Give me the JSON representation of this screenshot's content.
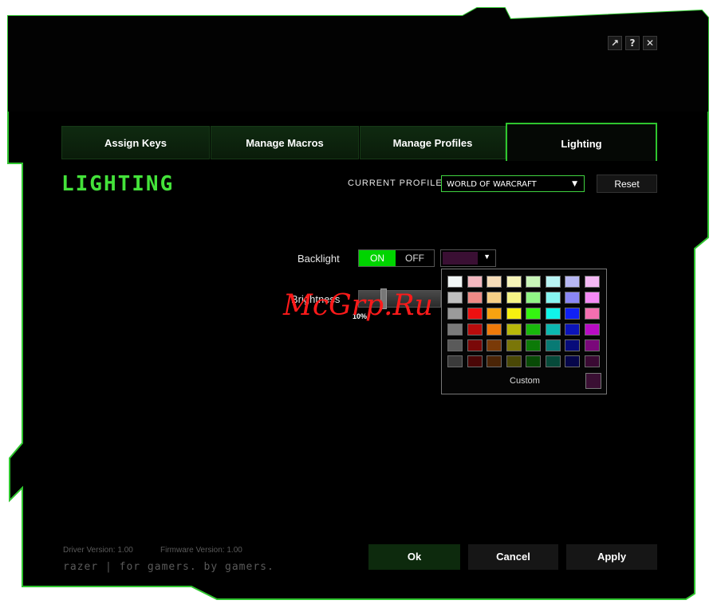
{
  "window": {
    "controls": [
      {
        "name": "settings-button",
        "glyph": "↗"
      },
      {
        "name": "help-button",
        "glyph": "?"
      },
      {
        "name": "close-button",
        "glyph": "✕"
      }
    ]
  },
  "tabs": [
    {
      "label": "Assign Keys"
    },
    {
      "label": "Manage Macros"
    },
    {
      "label": "Manage Profiles"
    },
    {
      "label": "Lighting"
    }
  ],
  "page_title": "Lighting",
  "profile": {
    "label": "CURRENT PROFILE",
    "value": "WORLD OF WARCRAFT",
    "reset_label": "Reset"
  },
  "backlight": {
    "label": "Backlight",
    "on_label": "ON",
    "off_label": "OFF",
    "selected": "ON",
    "color": "#3a0f33"
  },
  "brightness": {
    "label": "Brightness",
    "value_label": "10%",
    "value_percent": 10
  },
  "palette": {
    "rows": [
      [
        "#f2f7f7",
        "#f4b8c0",
        "#f6dcb8",
        "#f6f4b8",
        "#c8f4b8",
        "#b8f4f4",
        "#b8b8f4",
        "#f4b8f4"
      ],
      [
        "#bfbfbf",
        "#ee8a86",
        "#f6cf86",
        "#f6f486",
        "#90f486",
        "#86f4f0",
        "#8a86f4",
        "#f48af4"
      ],
      [
        "#9a9a9a",
        "#ee1010",
        "#f6a210",
        "#f6f010",
        "#34f410",
        "#10f4ea",
        "#1020f4",
        "#f46fb0"
      ],
      [
        "#7a7a7a",
        "#b80c0c",
        "#ee7a0a",
        "#b8b80a",
        "#18b80c",
        "#0cb8b0",
        "#0c14b8",
        "#b80cc4"
      ],
      [
        "#5a5a5a",
        "#7a0808",
        "#7a3a08",
        "#7a7608",
        "#0c7a08",
        "#087a74",
        "#080c7a",
        "#7a087a"
      ],
      [
        "#3a3a3a",
        "#4a0606",
        "#4a2406",
        "#4a4806",
        "#084a06",
        "#064a3a",
        "#06064a",
        "#3a0a33"
      ]
    ],
    "custom_label": "Custom",
    "custom_color": "#3a0f33"
  },
  "footer": {
    "driver_version": "Driver Version: 1.00",
    "firmware_version": "Firmware Version: 1.00",
    "brand": "razer | for gamers. by gamers."
  },
  "actions": {
    "ok_label": "Ok",
    "cancel_label": "Cancel",
    "apply_label": "Apply"
  },
  "watermark": "McGrp.Ru",
  "colors": {
    "accent": "#2fc52f",
    "title": "#44e23a",
    "panel": "#000000"
  }
}
